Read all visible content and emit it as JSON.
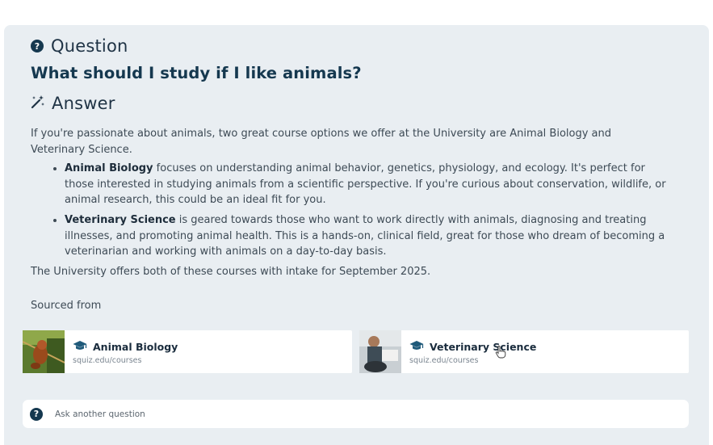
{
  "question_section": {
    "heading": "Question",
    "question": "What should I study if I like animals?"
  },
  "answer_section": {
    "heading": "Answer",
    "intro": "If you're passionate about animals, two great course options we offer at the University are Animal Biology and Veterinary Science.",
    "items": [
      {
        "term": "Animal Biology",
        "text": " focuses on understanding animal behavior, genetics, physiology, and ecology. It's perfect for those interested in studying animals from a scientific perspective. If you're curious about conservation, wildlife, or animal research, this could be an ideal fit for you."
      },
      {
        "term": "Veterinary Science",
        "text": " is geared towards those who want to work directly with animals, diagnosing and treating illnesses, and promoting animal health. This is a hands-on, clinical field, great for those who dream of becoming a veterinarian and working with animals on a day-to-day basis."
      }
    ],
    "outro": "The University offers both of these courses with intake for September 2025."
  },
  "sources": {
    "label": "Sourced from",
    "cards": [
      {
        "title": "Animal Biology",
        "url": "squiz.edu/courses",
        "icon": "graduation-cap-icon"
      },
      {
        "title": "Veterinary Science",
        "url": "squiz.edu/courses",
        "icon": "graduation-cap-icon"
      }
    ]
  },
  "ask": {
    "placeholder": "Ask another question",
    "icon": "question-circle-icon"
  },
  "icons": {
    "question": "question-circle-icon",
    "answer": "magic-wand-icon",
    "cursor": "hand-pointer-icon"
  },
  "colors": {
    "panel_bg": "#e9eef2",
    "brand_dark": "#15384f",
    "text": "#3d4a55"
  }
}
